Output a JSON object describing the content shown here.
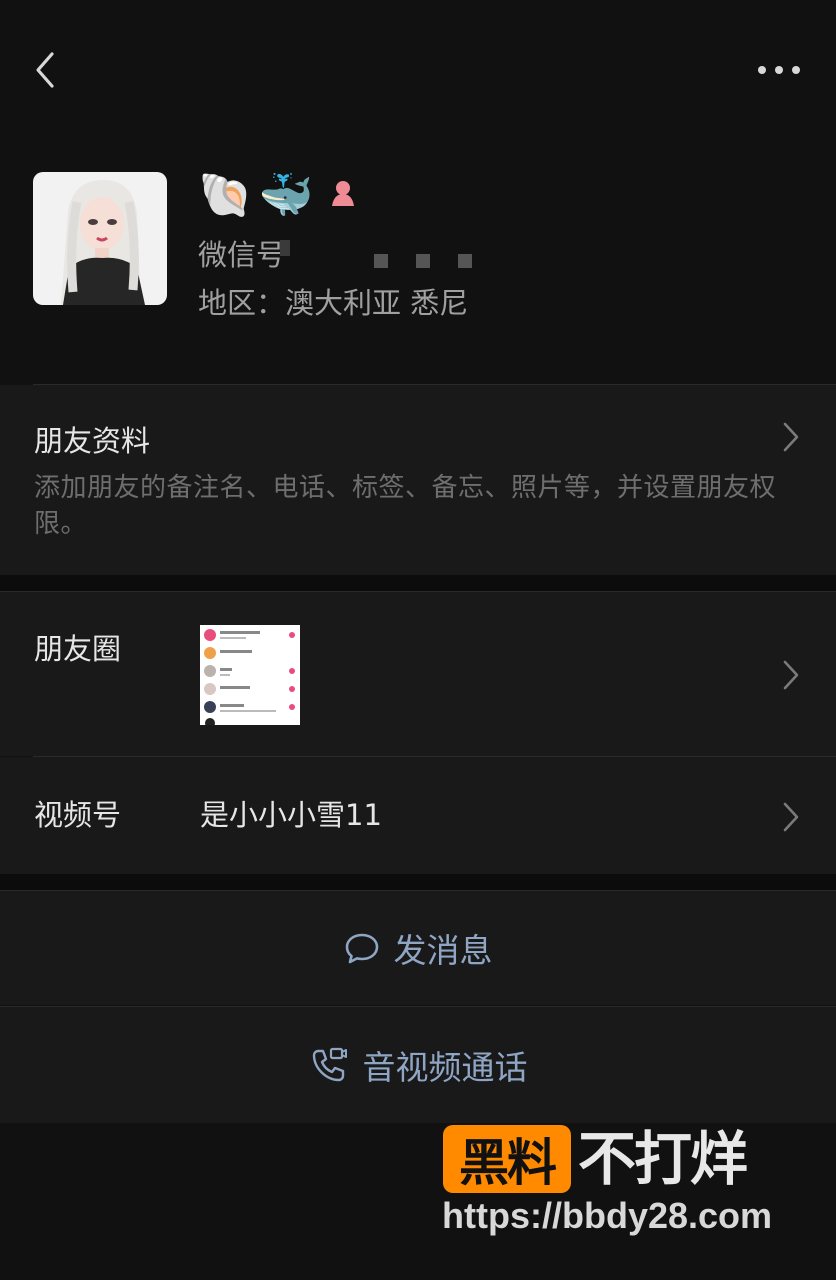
{
  "top_bar": {
    "back_icon": "chevron-left-icon",
    "more_icon": "more-dots-icon"
  },
  "profile": {
    "avatar": "avatar-image",
    "nickname_emojis": [
      "🐚",
      "🐳",
      "🛋"
    ],
    "wechat_id_label": "微信号",
    "region": "地区：澳大利亚 悉尼"
  },
  "friend_info": {
    "title": "朋友资料",
    "description": "添加朋友的备注名、电话、标签、备忘、照片等，并设置朋友权限。"
  },
  "moments": {
    "label": "朋友圈"
  },
  "channels": {
    "label": "视频号",
    "value": "是小小小雪11"
  },
  "actions": {
    "message": {
      "label": "发消息",
      "icon": "chat-bubble-icon"
    },
    "call": {
      "label": "音视频通话",
      "icon": "phone-video-icon"
    }
  },
  "watermark": {
    "badge": "黑料",
    "text": "不打烊",
    "url": "https://bbdy28.com"
  },
  "colors": {
    "background": "#111111",
    "panel": "#191919",
    "text_primary": "#e6e6e6",
    "text_secondary": "#a0a0a0",
    "action_blue": "#8fa5c4",
    "watermark_orange": "#ff8a00"
  }
}
